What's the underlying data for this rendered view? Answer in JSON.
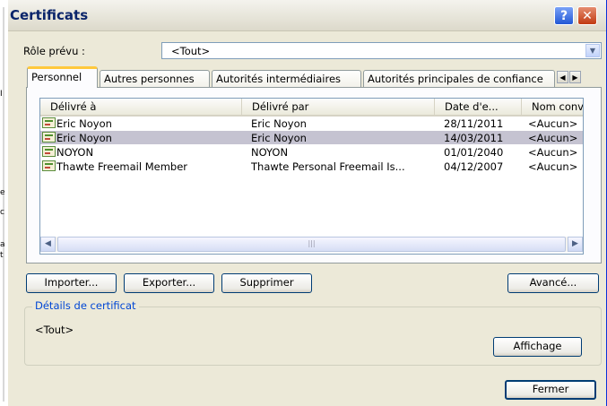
{
  "window": {
    "title": "Certificats"
  },
  "role": {
    "label": "Rôle prévu :",
    "value": "<Tout>"
  },
  "tabs": [
    {
      "label": "Personnel",
      "active": true
    },
    {
      "label": "Autres personnes",
      "active": false
    },
    {
      "label": "Autorités intermédiaires",
      "active": false
    },
    {
      "label": "Autorités principales de confiance",
      "active": false
    }
  ],
  "list": {
    "columns": [
      "Délivré à",
      "Délivré par",
      "Date d'e...",
      "Nom conv"
    ],
    "rows": [
      {
        "issued_to": "Eric Noyon",
        "issued_by": "Eric Noyon",
        "date": "28/11/2011",
        "name": "<Aucun>",
        "selected": false
      },
      {
        "issued_to": "Eric Noyon",
        "issued_by": "Eric Noyon",
        "date": "14/03/2011",
        "name": "<Aucun>",
        "selected": true
      },
      {
        "issued_to": "NOYON",
        "issued_by": "NOYON",
        "date": "01/01/2040",
        "name": "<Aucun>",
        "selected": false
      },
      {
        "issued_to": "Thawte Freemail Member",
        "issued_by": "Thawte Personal Freemail Is...",
        "date": "04/12/2007",
        "name": "<Aucun>",
        "selected": false
      }
    ]
  },
  "buttons": {
    "import": "Importer...",
    "export": "Exporter...",
    "delete": "Supprimer",
    "advanced": "Avancé...",
    "view": "Affichage",
    "close": "Fermer"
  },
  "details": {
    "legend": "Détails de certificat",
    "value": "<Tout>"
  },
  "icons": {
    "help": "help-icon",
    "close": "close-icon",
    "certificate": "certificate-icon"
  },
  "colors": {
    "accent": "#0046d5",
    "title": "#0a246a",
    "tab_highlight": "#ffc83c",
    "selection": "#c5c3d1"
  }
}
